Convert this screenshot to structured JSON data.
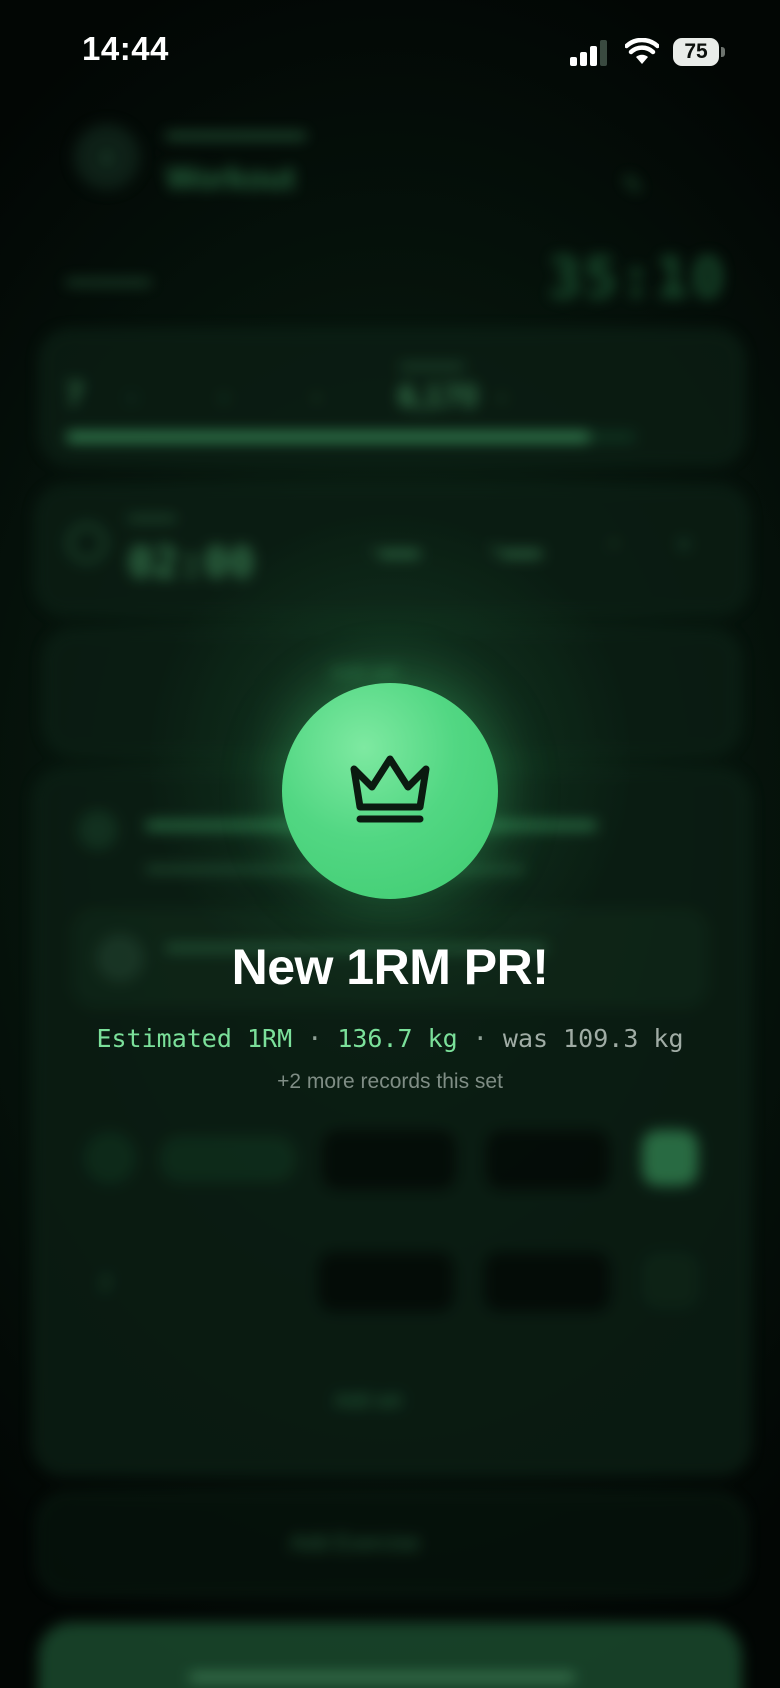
{
  "status_bar": {
    "time": "14:44",
    "battery": "75"
  },
  "pr_overlay": {
    "title": "New 1RM PR!",
    "metric_label": "Estimated 1RM",
    "new_value": "136.7 kg",
    "separator": "·",
    "previous_value": "was 109.3 kg",
    "more_records": "+2 more records this set",
    "icon": "crown-icon"
  },
  "colors": {
    "accent": "#52d783",
    "accent_text": "#7be09a",
    "background": "#020604"
  },
  "background_screen": {
    "workout_title": "Workout",
    "workout_timer": "35:10",
    "volume_value": "6,170",
    "rest_time": "02:00",
    "add_set": "Add set",
    "add_exercise": "Add Exercise",
    "progress": 0.92
  }
}
